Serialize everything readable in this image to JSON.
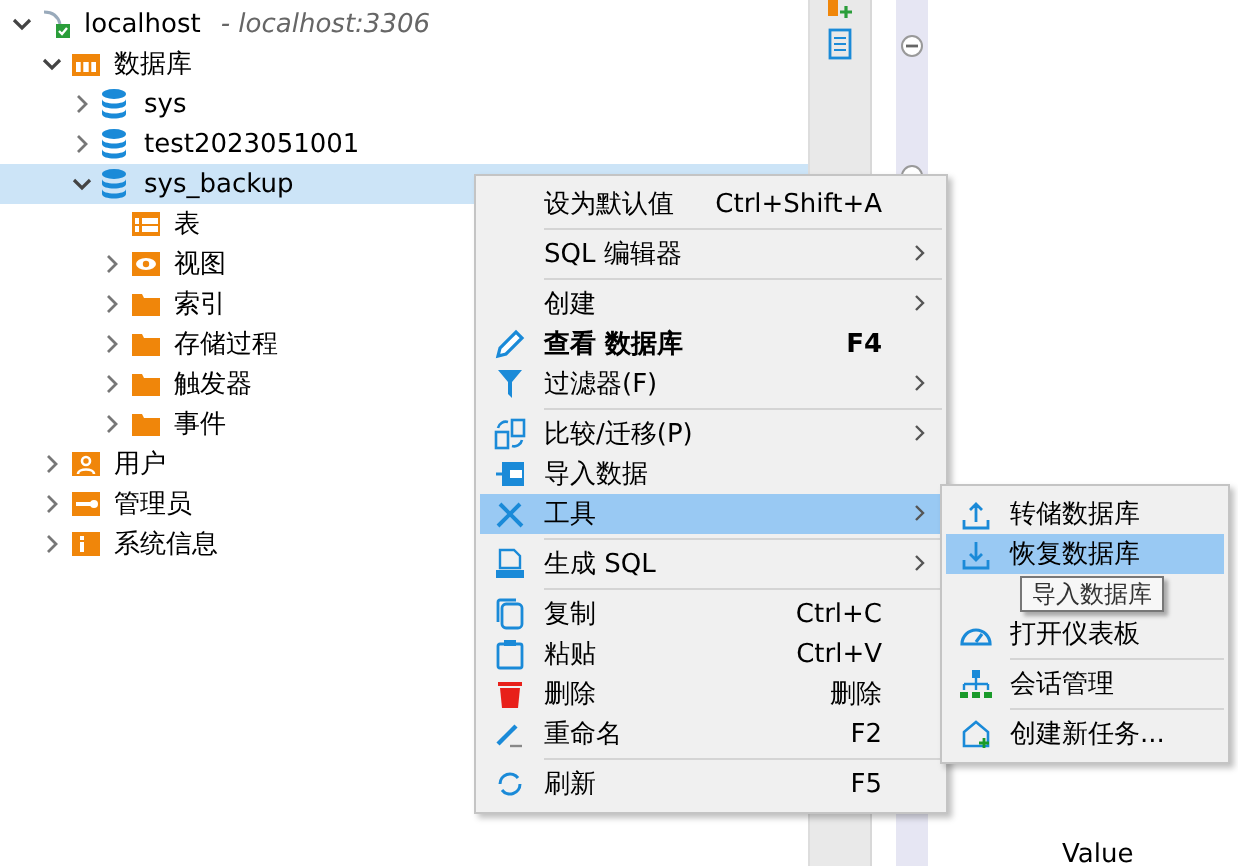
{
  "tree": {
    "label": "localhost",
    "host": "- localhost:3306",
    "kind": "server",
    "expanded": true,
    "selected": false,
    "children": [
      {
        "label": "数据库",
        "kind": "databases",
        "expanded": true,
        "selected": false,
        "children": [
          {
            "label": "sys",
            "kind": "db",
            "expanded": false,
            "selected": false
          },
          {
            "label": "test2023051001",
            "kind": "db",
            "expanded": false,
            "selected": false
          },
          {
            "label": "sys_backup",
            "kind": "db",
            "expanded": true,
            "selected": true,
            "children": [
              {
                "label": "表",
                "kind": "table",
                "selected": false
              },
              {
                "label": "视图",
                "kind": "view",
                "expanded": false,
                "selected": false
              },
              {
                "label": "索引",
                "kind": "folder",
                "expanded": false,
                "selected": false
              },
              {
                "label": "存储过程",
                "kind": "folder",
                "expanded": false,
                "selected": false
              },
              {
                "label": "触发器",
                "kind": "folder",
                "expanded": false,
                "selected": false
              },
              {
                "label": "事件",
                "kind": "folder",
                "expanded": false,
                "selected": false
              }
            ]
          }
        ]
      },
      {
        "label": "用户",
        "kind": "users",
        "expanded": false,
        "selected": false
      },
      {
        "label": "管理员",
        "kind": "admin",
        "expanded": false,
        "selected": false
      },
      {
        "label": "系统信息",
        "kind": "info",
        "expanded": false,
        "selected": false
      }
    ]
  },
  "diagram": {
    "text": "Value"
  },
  "context_menu": {
    "items": [
      {
        "kind": "item",
        "label": "设为默认值",
        "shortcut": "Ctrl+Shift+A",
        "submenu": false,
        "bold": false,
        "selected": false
      },
      {
        "kind": "separator"
      },
      {
        "kind": "item",
        "label": "SQL 编辑器",
        "submenu": true,
        "bold": false,
        "selected": false
      },
      {
        "kind": "separator"
      },
      {
        "kind": "item",
        "label": "创建",
        "submenu": true,
        "bold": false,
        "selected": false
      },
      {
        "kind": "item",
        "label": "查看 数据库",
        "shortcut": "F4",
        "submenu": false,
        "bold": true,
        "selected": false
      },
      {
        "kind": "item",
        "label": "过滤器(F)",
        "submenu": true,
        "bold": false,
        "selected": false
      },
      {
        "kind": "separator"
      },
      {
        "kind": "item",
        "label": "比较/迁移(P)",
        "submenu": true,
        "bold": false,
        "selected": false
      },
      {
        "kind": "item",
        "label": "导入数据",
        "submenu": false,
        "bold": false,
        "selected": false
      },
      {
        "kind": "item",
        "label": "工具",
        "submenu": true,
        "bold": false,
        "selected": true
      },
      {
        "kind": "separator"
      },
      {
        "kind": "item",
        "label": "生成 SQL",
        "submenu": true,
        "bold": false,
        "selected": false
      },
      {
        "kind": "separator"
      },
      {
        "kind": "item",
        "label": "复制",
        "shortcut": "Ctrl+C",
        "submenu": false,
        "bold": false,
        "selected": false
      },
      {
        "kind": "item",
        "label": "粘贴",
        "shortcut": "Ctrl+V",
        "submenu": false,
        "bold": false,
        "selected": false
      },
      {
        "kind": "item",
        "label": "删除",
        "shortcut": "删除",
        "submenu": false,
        "bold": false,
        "selected": false
      },
      {
        "kind": "item",
        "label": "重命名",
        "shortcut": "F2",
        "submenu": false,
        "bold": false,
        "selected": false
      },
      {
        "kind": "separator"
      },
      {
        "kind": "item",
        "label": "刷新",
        "shortcut": "F5",
        "submenu": false,
        "bold": false,
        "selected": false
      }
    ]
  },
  "tools_submenu": {
    "items": [
      {
        "kind": "item",
        "label": "转储数据库",
        "submenu": false,
        "bold": false,
        "selected": false
      },
      {
        "kind": "item",
        "label": "恢复数据库",
        "submenu": false,
        "bold": false,
        "selected": true
      },
      {
        "kind": "item"
      },
      {
        "kind": "item",
        "label": "打开仪表板",
        "submenu": false,
        "bold": false,
        "selected": false
      },
      {
        "kind": "separator"
      },
      {
        "kind": "item",
        "label": "会话管理",
        "submenu": false,
        "bold": false,
        "selected": false
      },
      {
        "kind": "separator"
      },
      {
        "kind": "item",
        "label": "创建新任务...",
        "submenu": false,
        "bold": false,
        "selected": false
      }
    ]
  },
  "tooltip": {
    "text": "导入数据库"
  }
}
